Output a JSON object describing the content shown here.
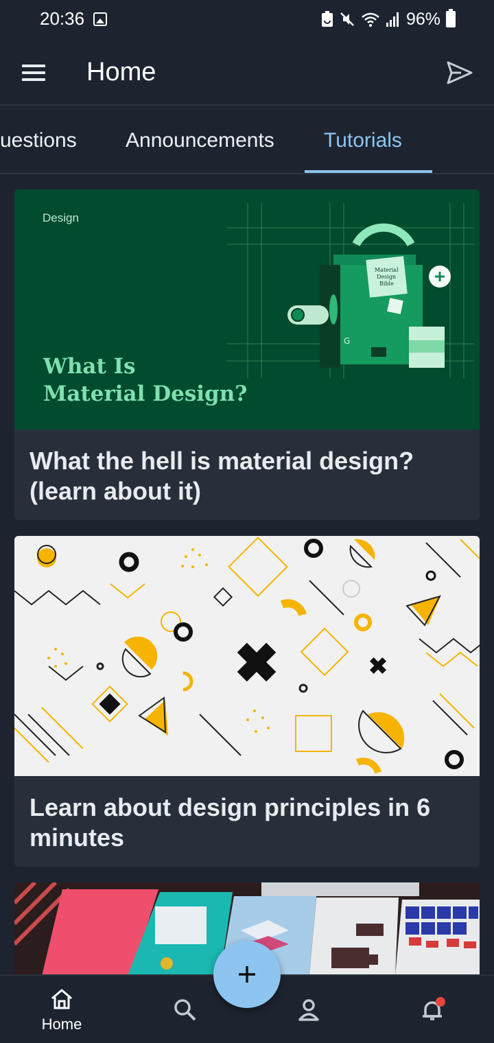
{
  "status_bar": {
    "time": "20:36",
    "battery": "96%",
    "icons": [
      "image-icon",
      "battery-saver-icon",
      "mute-icon",
      "wifi-icon",
      "signal-icon",
      "battery-icon"
    ]
  },
  "app_bar": {
    "title": "Home",
    "menu_icon": "menu-icon",
    "action_icon": "send-icon"
  },
  "tabs": [
    {
      "label": "uestions",
      "active": false
    },
    {
      "label": "Announcements",
      "active": false
    },
    {
      "label": "Tutorials",
      "active": true
    }
  ],
  "cards": [
    {
      "media_tag": "Design",
      "media_heading_line1": "What Is",
      "media_heading_line2": "Material Design?",
      "title": "What the hell is material design? (learn about it)"
    },
    {
      "title": "Learn about design principles in 6 minutes"
    },
    {
      "title": ""
    }
  ],
  "bottom_nav": {
    "items": [
      {
        "label": "Home",
        "icon": "home-icon",
        "active": true
      },
      {
        "label": "",
        "icon": "search-icon",
        "active": false
      },
      {
        "label": "",
        "icon": "profile-icon",
        "active": false
      },
      {
        "label": "",
        "icon": "notifications-icon",
        "active": false,
        "badge": true
      }
    ]
  },
  "fab": {
    "icon": "add-icon"
  },
  "colors": {
    "background": "#1d2430",
    "card": "#282f3b",
    "accent": "#8ec5f0",
    "badge": "#e8453c",
    "md_green": "#014b2e"
  }
}
